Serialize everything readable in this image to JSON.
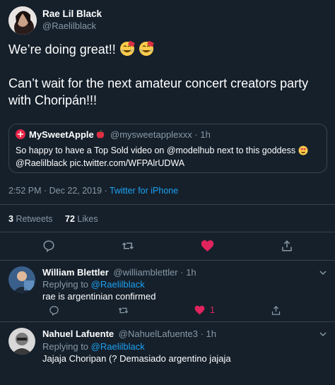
{
  "author": {
    "name": "Rae Lil Black",
    "handle": "@Raelilblack"
  },
  "tweet": {
    "line1": "We’re doing great!!",
    "line2": "Can’t wait for the next amateur concert creators party with Choripán!!!",
    "emojis": [
      "smiling-face-with-tear-icon",
      "smiling-face-with-tear-icon"
    ]
  },
  "quote": {
    "name": "MySweetApple",
    "handle": "@mysweetapplexxx",
    "time": "· 1h",
    "text1": "So happy to have a Top Sold video on @modelhub  next to this goddess",
    "text2": "@Raelilblack pic.twitter.com/WFPAlrUDWA"
  },
  "meta": {
    "timestamp": "2:52 PM · Dec 22, 2019 ·",
    "source": "Twitter for iPhone"
  },
  "stats": {
    "retweets_count": "3",
    "retweets_label": "Retweets",
    "likes_count": "72",
    "likes_label": "Likes"
  },
  "replies": [
    {
      "name": "William Blettler",
      "handle": "@williamblettler",
      "time": "· 1h",
      "replying_prefix": "Replying to",
      "replying_to": "@Raelilblack",
      "text": "rae is argentinian confirmed",
      "like_count": "1"
    },
    {
      "name": "Nahuel Lafuente",
      "handle": "@NahuelLafuente3",
      "time": "· 1h",
      "replying_prefix": "Replying to",
      "replying_to": "@Raelilblack",
      "text": "Jajaja Choripan (? Demasiado argentino jajaja",
      "like_count": ""
    }
  ],
  "colors": {
    "background": "#15202b",
    "accent": "#1da1f2",
    "like": "#e0245e",
    "muted": "#8899a6",
    "border": "#38444d"
  }
}
